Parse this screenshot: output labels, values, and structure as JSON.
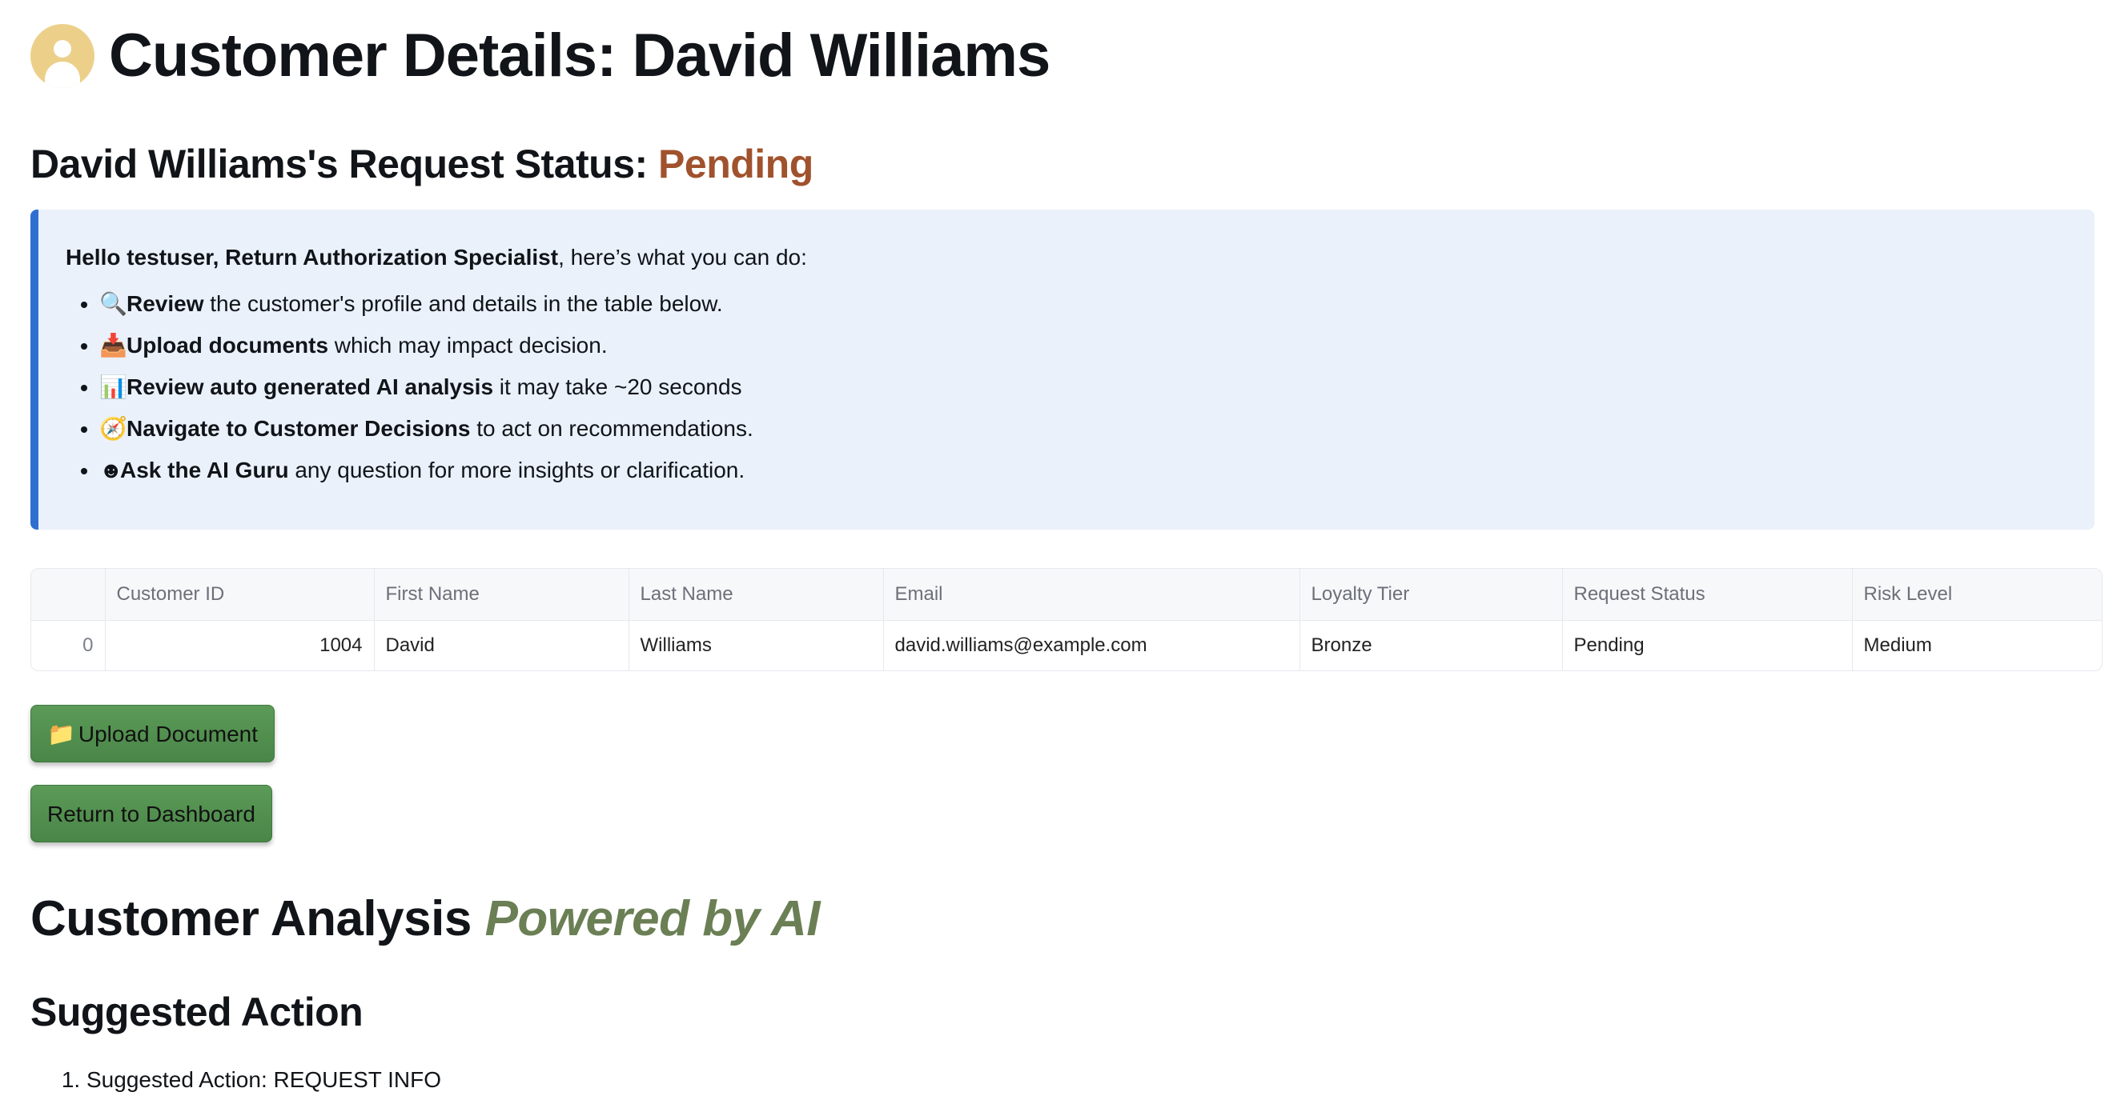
{
  "header": {
    "avatar_icon": "user-circle-icon",
    "title": "Customer Details: David Williams"
  },
  "status": {
    "prefix": "David Williams's Request Status: ",
    "value": "Pending",
    "value_color": "#a0522d"
  },
  "info": {
    "greeting_bold": "Hello testuser, Return Authorization Specialist",
    "greeting_rest": ", here’s what you can do:",
    "items": [
      {
        "icon": "magnifier-icon",
        "glyph": "🔍",
        "bold": "Review",
        "rest": " the customer's profile and details in the table below."
      },
      {
        "icon": "inbox-tray-icon",
        "glyph": "📥",
        "bold": "Upload documents",
        "rest": " which may impact decision."
      },
      {
        "icon": "bar-chart-icon",
        "glyph": "📊",
        "bold": "Review auto generated AI analysis",
        "rest": " it may take ~20 seconds"
      },
      {
        "icon": "compass-icon",
        "glyph": "🧭",
        "bold": "Navigate to Customer Decisions",
        "rest": " to act on recommendations."
      },
      {
        "icon": "ai-guru-icon",
        "glyph": "☻",
        "bold": "Ask the AI Guru",
        "rest": " any question for more insights or clarification."
      }
    ]
  },
  "table": {
    "columns": [
      "",
      "Customer ID",
      "First Name",
      "Last Name",
      "Email",
      "Loyalty Tier",
      "Request Status",
      "Risk Level"
    ],
    "rows": [
      [
        "0",
        "1004",
        "David",
        "Williams",
        "david.williams@example.com",
        "Bronze",
        "Pending",
        "Medium"
      ]
    ]
  },
  "buttons": {
    "upload_icon": "folder-icon",
    "upload_glyph": "📁",
    "upload_label": "Upload Document",
    "return_label": "Return to Dashboard",
    "color": "#4a8648"
  },
  "analysis": {
    "heading": "Customer Analysis ",
    "accent": "Powered by AI",
    "suggested_heading": "Suggested Action",
    "suggestions": [
      "Suggested Action: REQUEST INFO"
    ]
  }
}
